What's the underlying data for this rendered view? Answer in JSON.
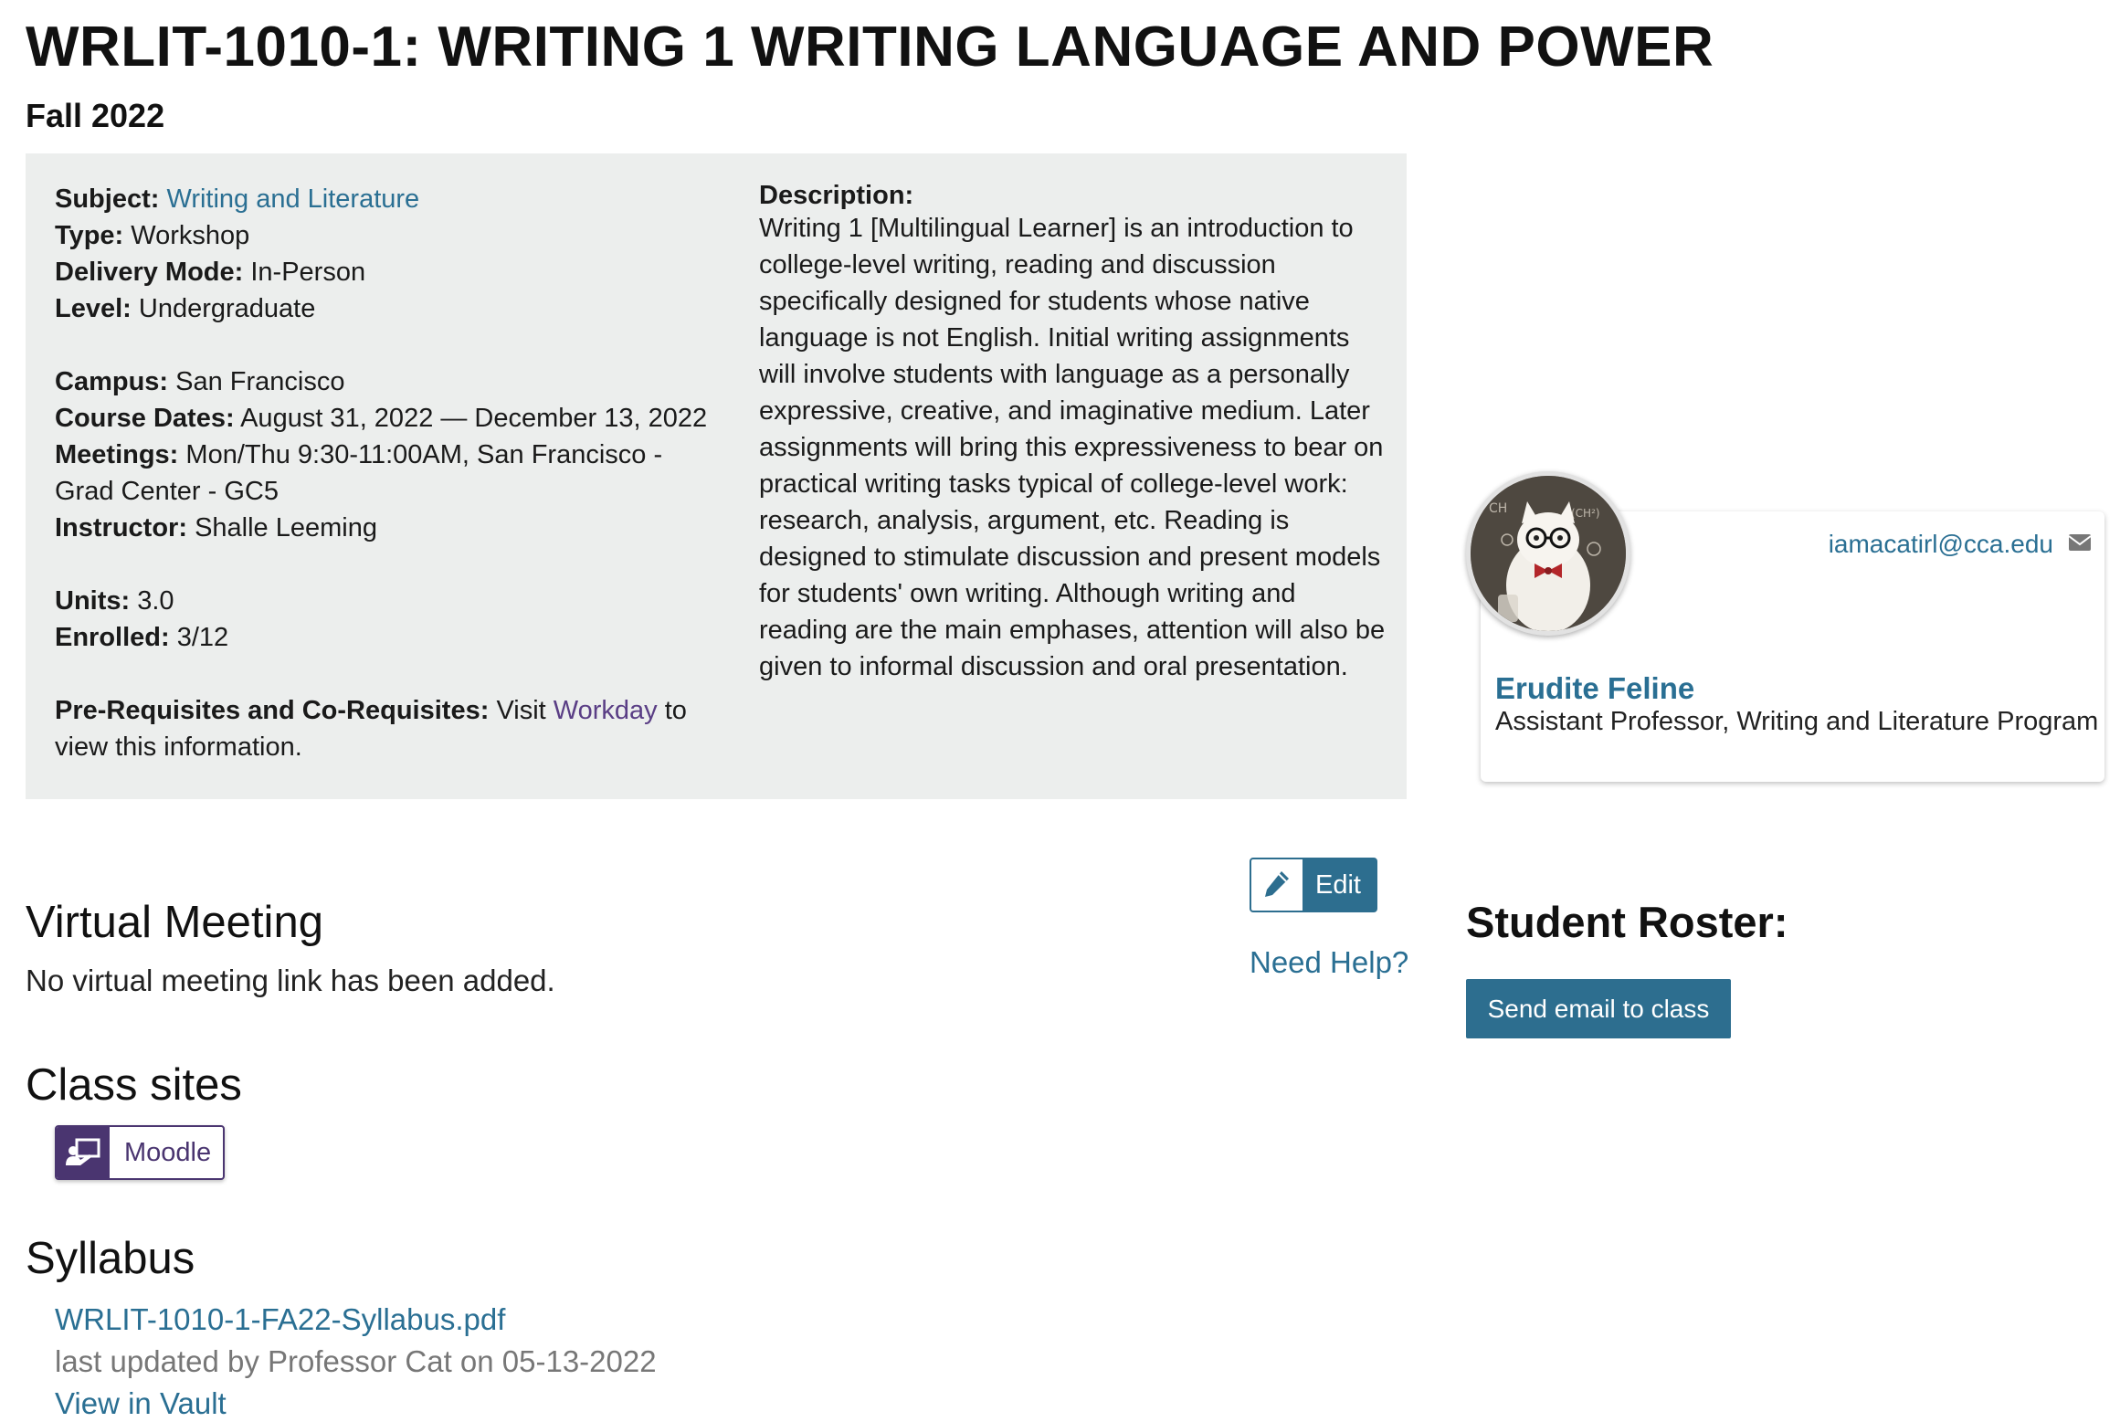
{
  "course": {
    "title": "WRLIT-1010-1: WRITING 1 WRITING LANGUAGE AND POWER",
    "term": "Fall 2022"
  },
  "details": {
    "subject_label": "Subject:",
    "subject_value": "Writing and Literature",
    "type_label": "Type:",
    "type_value": "Workshop",
    "delivery_label": "Delivery Mode:",
    "delivery_value": "In-Person",
    "level_label": "Level:",
    "level_value": "Undergraduate",
    "campus_label": "Campus:",
    "campus_value": "San Francisco",
    "dates_label": "Course Dates:",
    "dates_value": "August 31, 2022 — December 13, 2022",
    "meetings_label": "Meetings:",
    "meetings_value": "Mon/Thu 9:30-11:00AM, San Francisco - Grad Center - GC5",
    "instructor_label": "Instructor:",
    "instructor_value": "Shalle Leeming",
    "units_label": "Units:",
    "units_value": "3.0",
    "enrolled_label": "Enrolled:",
    "enrolled_value": "3/12",
    "prereq_label": "Pre-Requisites and Co-Requisites:",
    "prereq_text_before": "Visit",
    "prereq_link": "Workday",
    "prereq_text_after": "to view this information."
  },
  "description": {
    "label": "Description:",
    "text": "Writing 1 [Multilingual Learner] is an introduction to college-level writing, reading and discussion specifically designed for students whose native language is not English. Initial writing assignments will involve students with language as a personally expressive, creative, and imaginative medium. Later assignments will bring this expressiveness to bear on practical writing tasks typical of college-level work: research, analysis, argument, etc. Reading is designed to stimulate discussion and present models for students' own writing. Although writing and reading are the main emphases, attention will also be given to informal discussion and oral presentation."
  },
  "instructor_card": {
    "email": "iamacatirl@cca.edu",
    "name": "Erudite Feline",
    "role": "Assistant Professor, Writing and Literature Program"
  },
  "virtual_meeting": {
    "heading": "Virtual Meeting",
    "text": "No virtual meeting link has been added.",
    "edit_label": "Edit",
    "help_label": "Need Help?"
  },
  "roster": {
    "heading": "Student Roster:",
    "send_label": "Send email to class"
  },
  "class_sites": {
    "heading": "Class sites",
    "moodle_label": "Moodle"
  },
  "syllabus": {
    "heading": "Syllabus",
    "file": "WRLIT-1010-1-FA22-Syllabus.pdf",
    "updated": "last updated by Professor Cat on 05-13-2022",
    "vault_link": "View in Vault"
  },
  "colors": {
    "link": "#2a6f93",
    "button": "#2d6e8f",
    "moodle": "#4a3570",
    "info_bg": "#eceeed"
  }
}
